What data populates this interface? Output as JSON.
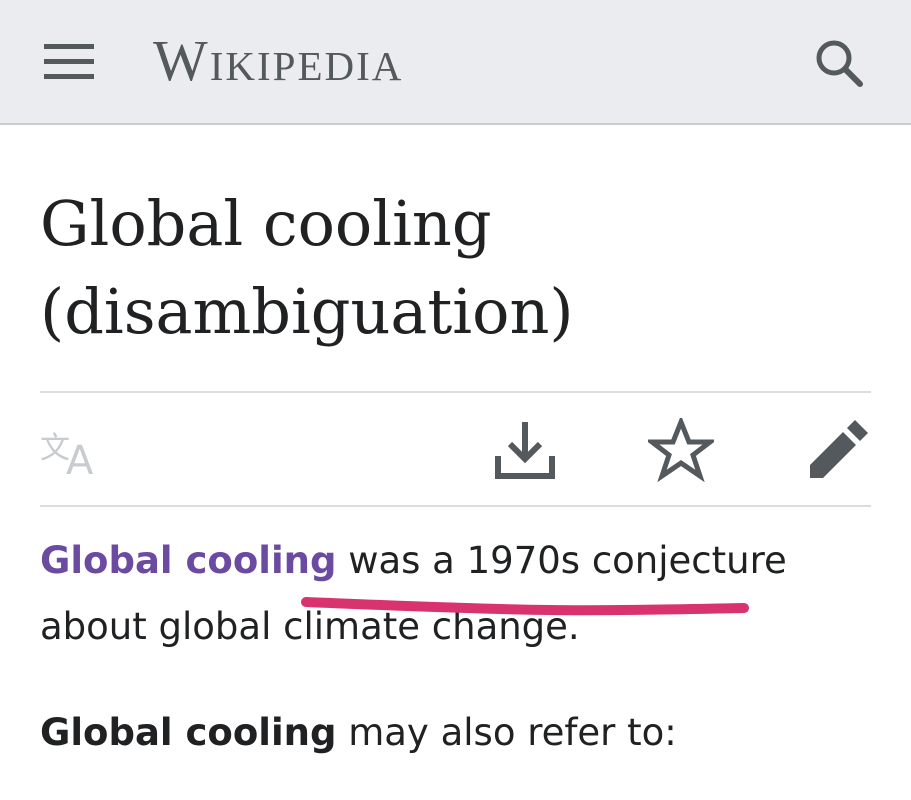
{
  "header": {
    "wordmark": "Wikipedia",
    "menu_icon": "hamburger-menu-icon",
    "search_icon": "search-icon",
    "background": "#eaecf0"
  },
  "page": {
    "title": "Global cooling (disambiguation)"
  },
  "actions": {
    "icons": [
      "language-icon",
      "download-icon",
      "star-icon",
      "edit-pencil-icon"
    ]
  },
  "content": {
    "intro_link": "Global cooling",
    "intro_rest": " was a 1970s conjecture about global climate change.",
    "refer_bold": "Global cooling",
    "refer_rest": " may also refer to:"
  },
  "colors": {
    "link": "#6b4ba1",
    "annotation": "#d8336e",
    "icon": "#54595d"
  }
}
